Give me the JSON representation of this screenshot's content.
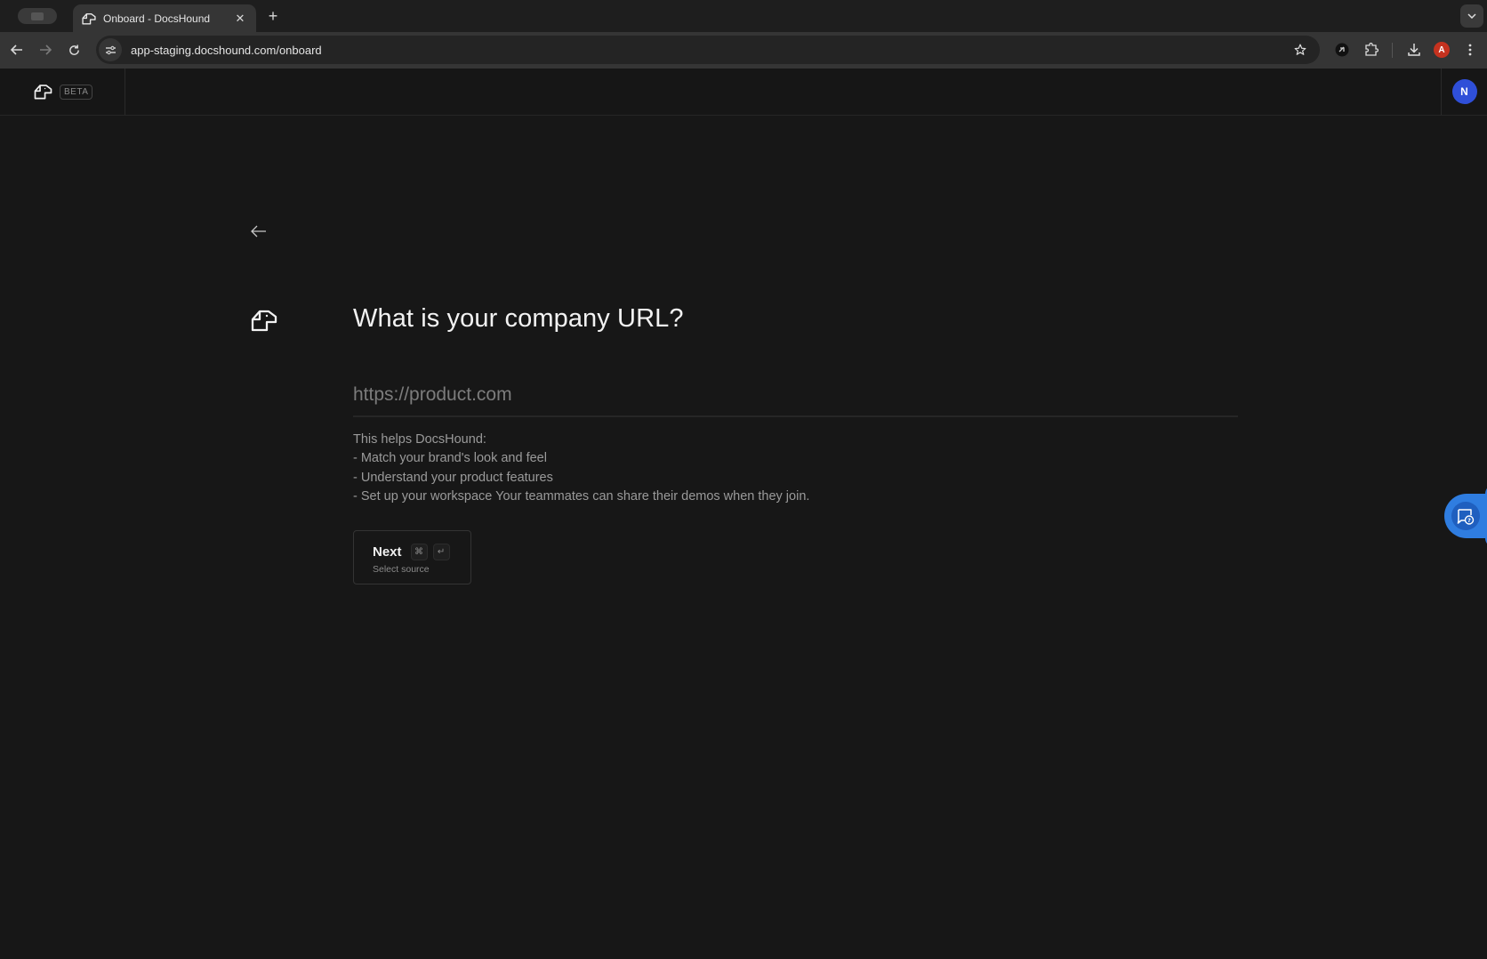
{
  "browser": {
    "tab": {
      "title": "Onboard - DocsHound",
      "favicon": "docshound-logo-icon"
    },
    "new_tab_label": "+",
    "address_bar": {
      "url": "app-staging.docshound.com/onboard"
    },
    "profile_initial": "A",
    "icons": [
      "back-icon",
      "forward-icon",
      "reload-icon",
      "site-settings-icon",
      "star-icon",
      "extension-icon",
      "puzzle-icon",
      "download-icon",
      "kebab-menu-icon"
    ]
  },
  "header": {
    "badge": "BETA",
    "user_initial": "N",
    "colors": {
      "avatar": "#2f4fd8"
    }
  },
  "main": {
    "question": "What is your company URL?",
    "url_input": {
      "value": "",
      "placeholder": "https://product.com"
    },
    "helper": {
      "intro": "This helps DocsHound:",
      "items": [
        "- Match your brand's look and feel",
        "- Understand your product features",
        "- Set up your workspace Your teammates can share their demos when they join."
      ]
    },
    "next_button": {
      "label": "Next",
      "shortcut": [
        "⌘",
        "↵"
      ],
      "sublabel": "Select source"
    }
  },
  "help_widget": {
    "icon": "chat-help-icon",
    "color": "#2f7de0"
  }
}
